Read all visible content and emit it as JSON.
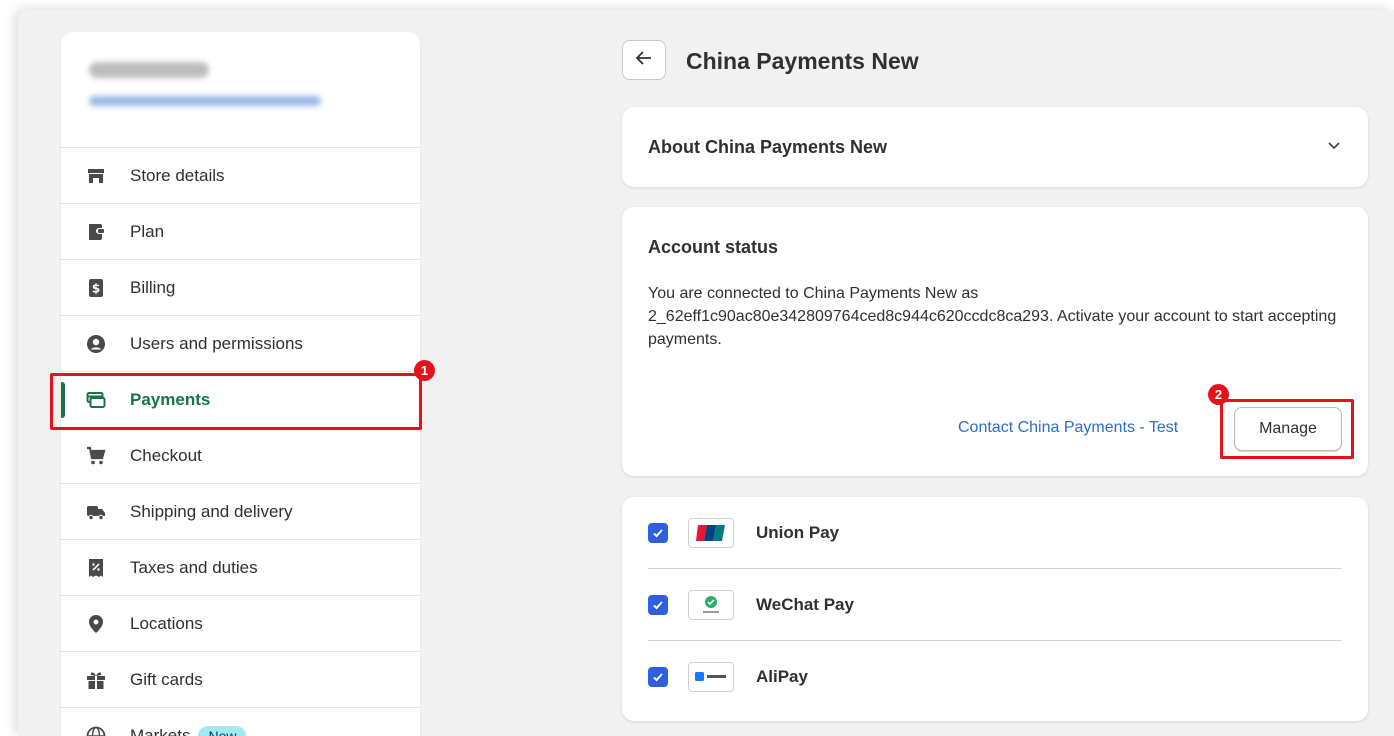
{
  "sidebar": {
    "items": [
      {
        "label": "Store details",
        "icon": "store-icon"
      },
      {
        "label": "Plan",
        "icon": "wallet-icon"
      },
      {
        "label": "Billing",
        "icon": "billing-icon"
      },
      {
        "label": "Users and permissions",
        "icon": "user-icon"
      },
      {
        "label": "Payments",
        "icon": "payments-icon",
        "active": true
      },
      {
        "label": "Checkout",
        "icon": "cart-icon"
      },
      {
        "label": "Shipping and delivery",
        "icon": "truck-icon"
      },
      {
        "label": "Taxes and duties",
        "icon": "tax-icon"
      },
      {
        "label": "Locations",
        "icon": "location-pin-icon"
      },
      {
        "label": "Gift cards",
        "icon": "gift-icon"
      },
      {
        "label": "Markets",
        "icon": "globe-icon",
        "badge": "New"
      }
    ]
  },
  "annotations": {
    "step1": "1",
    "step2": "2",
    "color": "#e4131b"
  },
  "header": {
    "title": "China Payments New"
  },
  "about": {
    "title": "About China Payments New"
  },
  "status": {
    "title": "Account status",
    "text": "You are connected to China Payments New as 2_62eff1c90ac80e342809764ced8c944c620ccdc8ca293. Activate your account to start accepting payments.",
    "contact_link": "Contact China Payments - Test",
    "manage_label": "Manage"
  },
  "methods": [
    {
      "name": "Union Pay",
      "checked": true,
      "logo": "unionpay-logo-icon"
    },
    {
      "name": "WeChat Pay",
      "checked": true,
      "logo": "wechat-logo-icon"
    },
    {
      "name": "AliPay",
      "checked": true,
      "logo": "alipay-logo-icon"
    }
  ],
  "colors": {
    "active": "#1a7346",
    "link": "#2c6ecb",
    "checkbox": "#2d5fe0",
    "badge": "#a4e8f2"
  }
}
